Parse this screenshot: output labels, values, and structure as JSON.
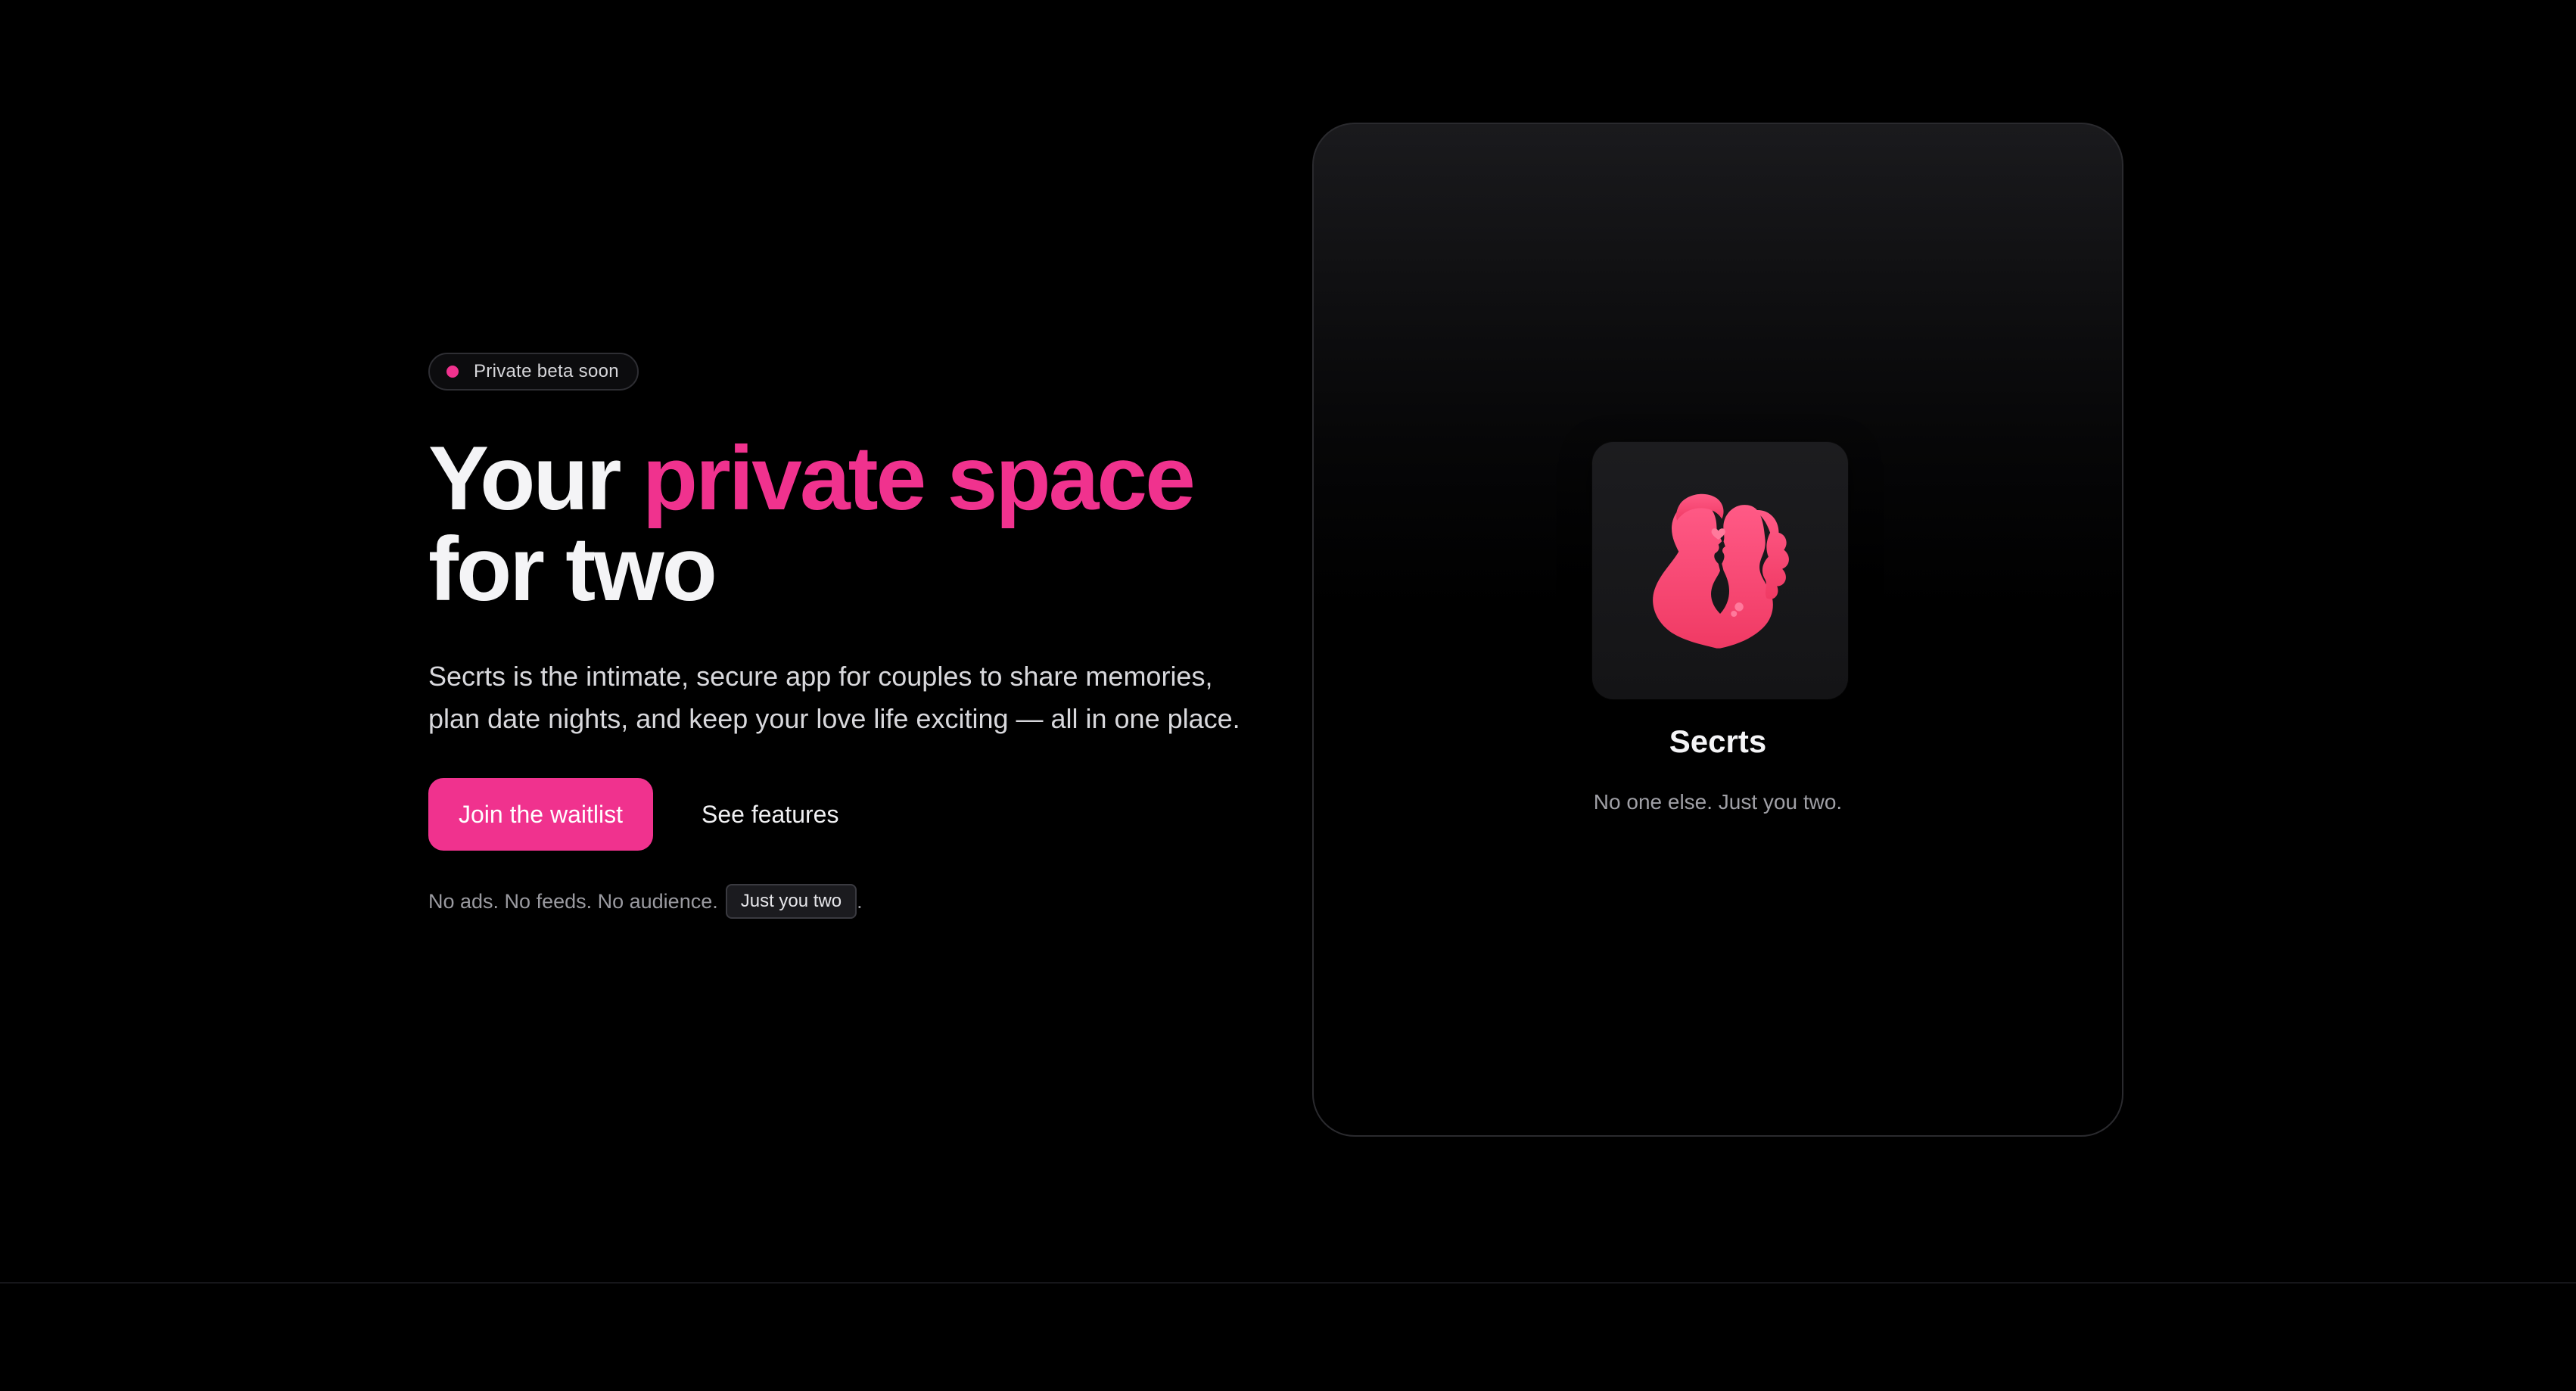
{
  "badge": {
    "text": "Private beta soon"
  },
  "headline": {
    "part1": "Your ",
    "accent": "private space",
    "line2": "for two"
  },
  "subtext": {
    "line1": "Secrts is the intimate, secure app for couples to share memories,",
    "line2": "plan date nights, and keep your love life exciting — all in one place."
  },
  "cta": {
    "primary_label": "Join the waitlist",
    "secondary_label": "See features"
  },
  "footnote": {
    "text": "No ads. No feeds. No audience.",
    "pill": "Just you two",
    "trailing": "."
  },
  "card": {
    "app_icon": "couple-kiss-silhouette-icon",
    "app_name": "Secrts",
    "tagline": "No one else. Just you two."
  },
  "colors": {
    "accent": "#f0328e",
    "icon": "#f5416f",
    "background": "#000000"
  }
}
